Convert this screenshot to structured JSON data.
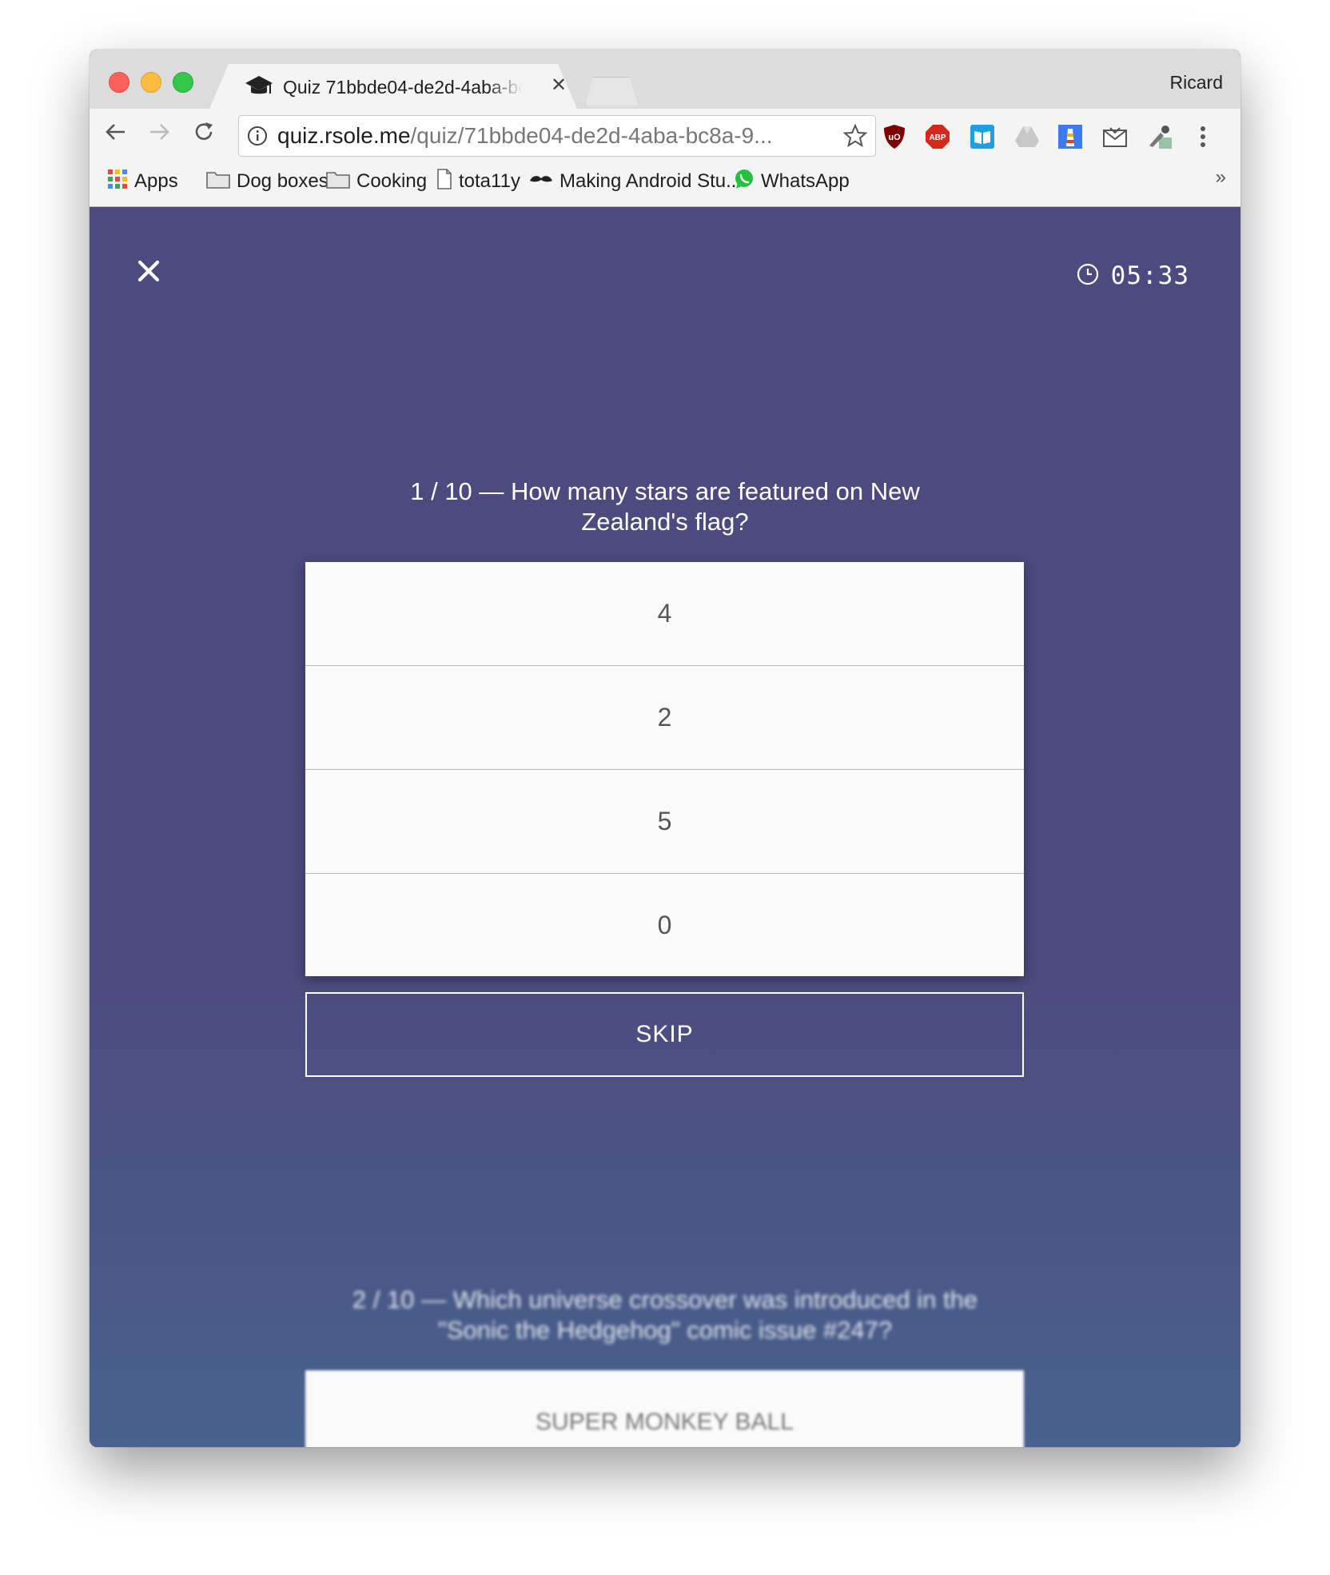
{
  "browser": {
    "tab_title": "Quiz 71bbde04-de2d-4aba-bc8a-9",
    "profile_name": "Ricard",
    "url_host": "quiz.rsole.me",
    "url_path": "/quiz/71bbde04-de2d-4aba-bc8a-9...",
    "bookmarks": [
      {
        "label": "Apps"
      },
      {
        "label": "Dog boxes"
      },
      {
        "label": "Cooking"
      },
      {
        "label": "tota11y"
      },
      {
        "label": "Making Android Stu..."
      },
      {
        "label": "WhatsApp"
      }
    ],
    "bookmarks_more": "»",
    "extensions": [
      "ublock-origin-icon",
      "adblock-plus-icon",
      "reader-icon",
      "google-drive-icon",
      "lighthouse-icon",
      "mail-icon",
      "eyedropper-icon",
      "menu-dots-icon"
    ]
  },
  "quiz": {
    "timer": "05:33",
    "question": "1 / 10 — How many stars are featured on New Zealand's flag?",
    "answers": [
      "4",
      "2",
      "5",
      "0"
    ],
    "skip_label": "SKIP",
    "next_question": "2 / 10 — Which universe crossover was introduced in the \"Sonic the Hedgehog\" comic issue #247?",
    "next_first_answer": "SUPER MONKEY BALL"
  },
  "colors": {
    "background": "#4c4a7e",
    "card": "#fafafa",
    "text_light": "#ffffff"
  }
}
